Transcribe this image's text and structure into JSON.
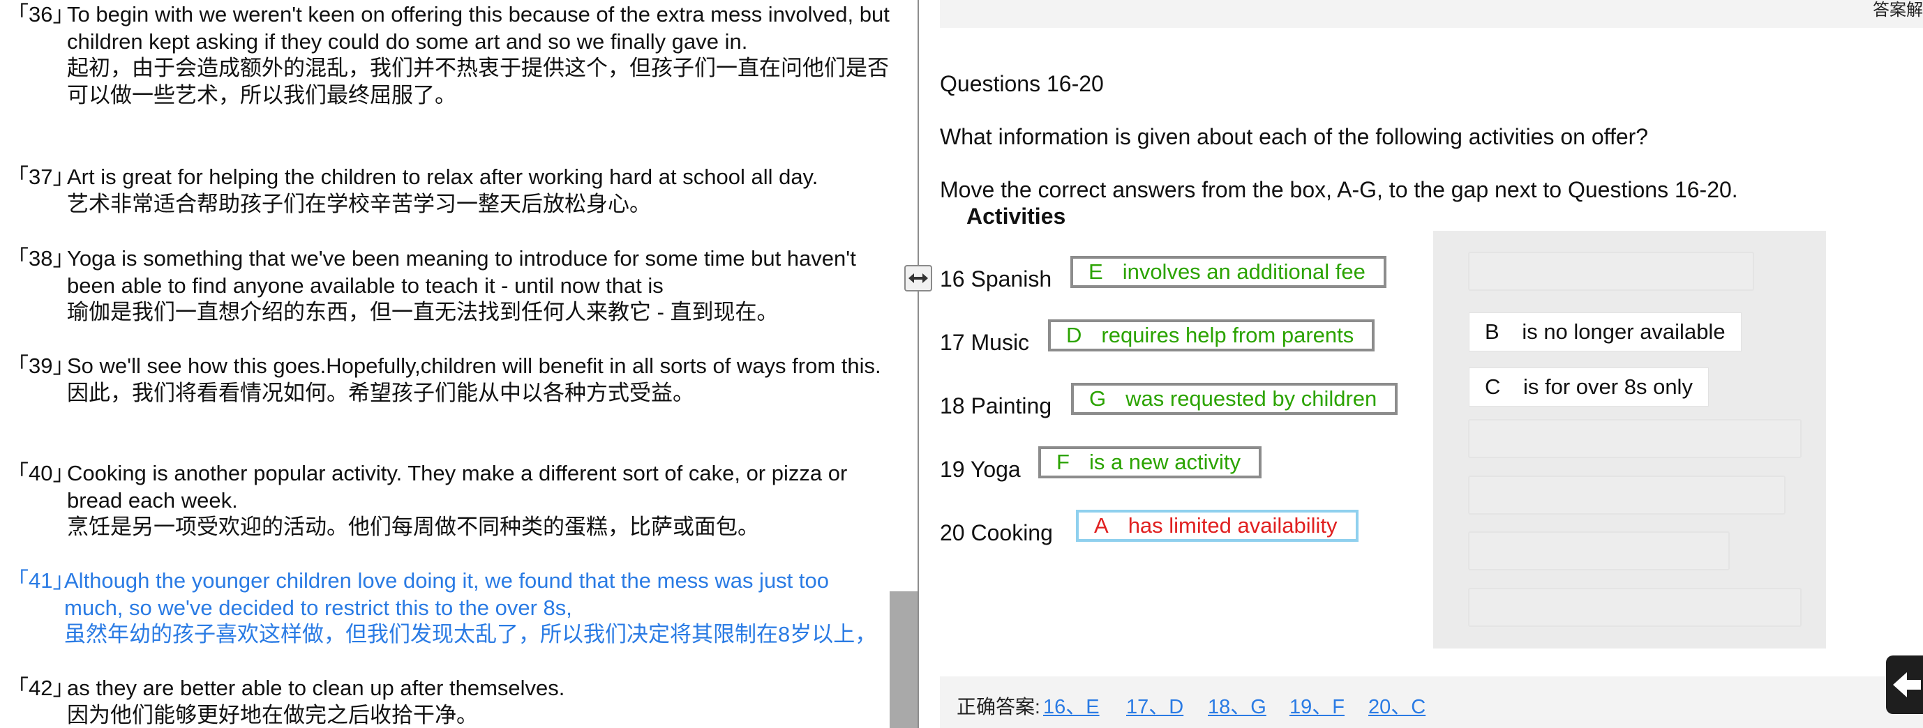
{
  "transcript": [
    {
      "num": "「36」",
      "en": "To begin with we weren't keen on offering this because of the extra mess involved, but children kept asking if they could do some art and so we finally gave in.",
      "zh": "起初，由于会造成额外的混乱，我们并不热衷于提供这个，但孩子们一直在问他们是否可以做一些艺术，所以我们最终屈服了。"
    },
    {
      "num": "「37」",
      "en": "Art is great for helping the children to relax after working hard at school all day.",
      "zh": "艺术非常适合帮助孩子们在学校辛苦学习一整天后放松身心。"
    },
    {
      "num": "「38」",
      "en": "Yoga is something that we've been meaning to introduce for some time but haven't been able to find anyone available to teach it - until now that is",
      "zh": "瑜伽是我们一直想介绍的东西，但一直无法找到任何人来教它 - 直到现在。"
    },
    {
      "num": "「39」",
      "en": "So we'll see how this goes.Hopefully,children will benefit in all sorts of ways from this.",
      "zh": "因此，我们将看看情况如何。希望孩子们能从中以各种方式受益。"
    },
    {
      "num": "「40」",
      "en": "Cooking is another popular activity. They make a different sort of cake, or pizza or bread each week.",
      "zh": "烹饪是另一项受欢迎的活动。他们每周做不同种类的蛋糕，比萨或面包。"
    },
    {
      "num": "「41」",
      "en": "Although the younger children love doing it, we found that the mess was just too much, so we've decided to restrict this to the over 8s,",
      "zh": "虽然年幼的孩子喜欢这样做，但我们发现太乱了，所以我们决定将其限制在8岁以上，"
    },
    {
      "num": "「42」",
      "en": "as they are better able to clean up after themselves.",
      "zh": "因为他们能够更好地在做完之后收拾干净。"
    }
  ],
  "top_bar": {
    "text": "答案解"
  },
  "question": {
    "heading": "Questions 16-20",
    "prompt": "What information is given about each of the following activities on offer?",
    "instruction": "Move the correct answers from the box, A-G, to the gap next to Questions 16-20.",
    "box_title": "Activities"
  },
  "items": [
    {
      "label": "16 Spanish",
      "letter": "E",
      "text": "involves an additional fee",
      "status": "correct"
    },
    {
      "label": "17 Music",
      "letter": "D",
      "text": "requires help from parents",
      "status": "correct"
    },
    {
      "label": "18 Painting",
      "letter": "G",
      "text": "was requested by children",
      "status": "correct"
    },
    {
      "label": "19 Yoga",
      "letter": "F",
      "text": "is a new activity",
      "status": "correct"
    },
    {
      "label": "20 Cooking",
      "letter": "A",
      "text": "has limited availability",
      "status": "wrong"
    }
  ],
  "options_remaining": [
    {
      "letter": "B",
      "text": "is no longer available"
    },
    {
      "letter": "C",
      "text": "is for over 8s only"
    }
  ],
  "answers": {
    "label": "正确答案:",
    "links": [
      "16、E",
      "17、D",
      "18、G",
      "19、F",
      "20、C"
    ]
  },
  "colors": {
    "correct": "#2ba300",
    "wrong": "#e02020",
    "highlight": "#2a7be4"
  },
  "icons": {
    "resize": "resize-horizontal-icon",
    "back": "arrow-left-icon"
  }
}
